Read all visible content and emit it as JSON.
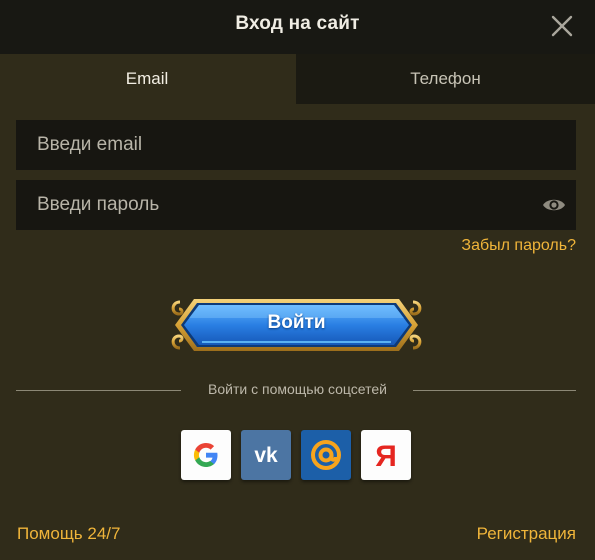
{
  "header": {
    "title": "Вход на сайт"
  },
  "tabs": [
    {
      "label": "Email",
      "active": true
    },
    {
      "label": "Телефон",
      "active": false
    }
  ],
  "form": {
    "email_placeholder": "Введи email",
    "email_value": "",
    "password_placeholder": "Введи пароль",
    "password_value": "",
    "forgot_label": "Забыл пароль?",
    "login_label": "Войти"
  },
  "social": {
    "label": "Войти с помощью соцсетей",
    "providers": [
      "google-icon",
      "vk-icon",
      "mailru-icon",
      "yandex-icon"
    ]
  },
  "footer": {
    "help_label": "Помощь 24/7",
    "register_label": "Регистрация"
  },
  "colors": {
    "background": "#302c1a",
    "header": "#181813",
    "accent": "#f0b53a",
    "button_blue": "#2a7fe3",
    "gold_frame": "#d7a236"
  }
}
